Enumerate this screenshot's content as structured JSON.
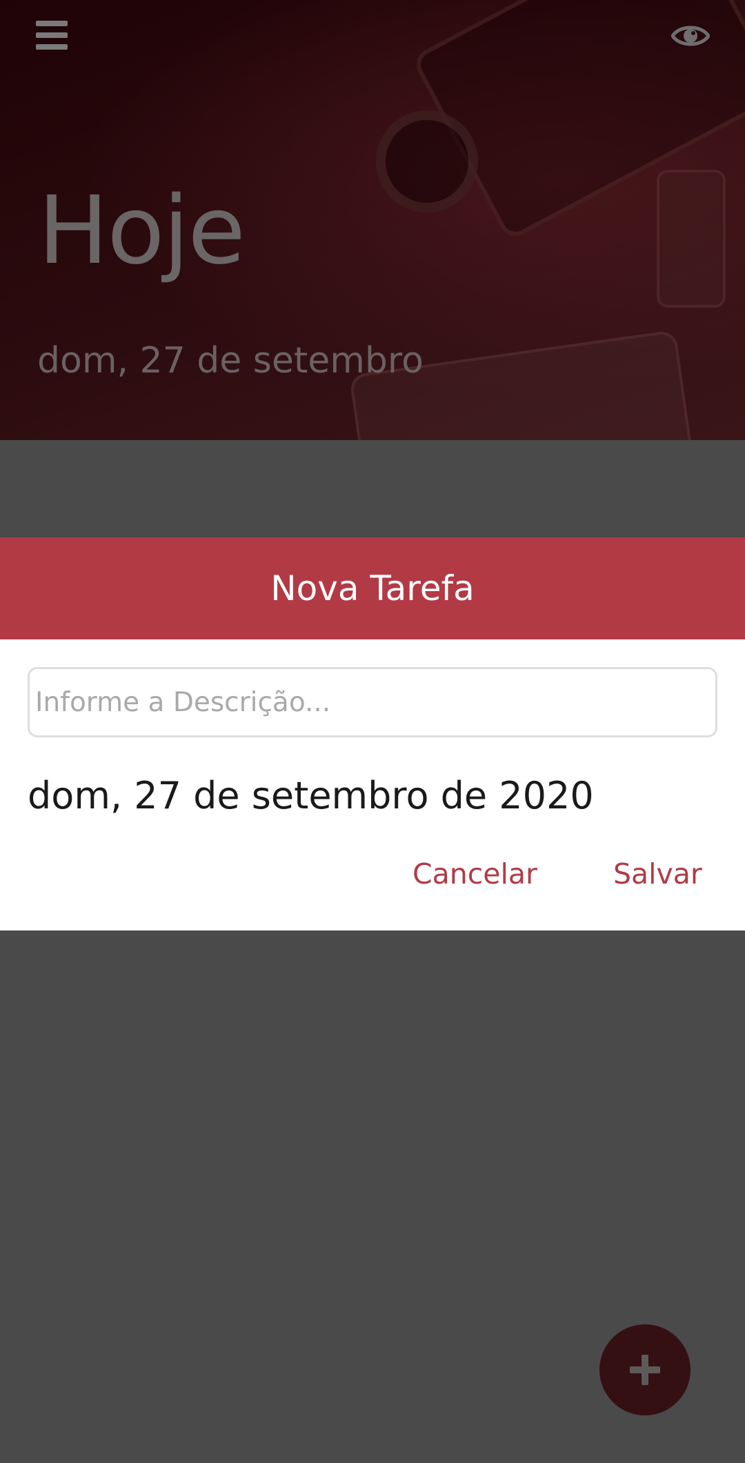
{
  "header": {
    "title": "Hoje",
    "date": "dom, 27 de setembro",
    "menu_icon": "menu-icon",
    "visibility_icon": "eye-icon"
  },
  "modal": {
    "title": "Nova Tarefa",
    "description_placeholder": "Informe a Descrição...",
    "description_value": "",
    "date": "dom, 27 de setembro de 2020",
    "cancel_label": "Cancelar",
    "save_label": "Salvar"
  },
  "fab": {
    "icon": "plus-icon"
  },
  "colors": {
    "accent": "#b23a45",
    "overlay": "#4a4a4a",
    "fab": "#351012"
  }
}
